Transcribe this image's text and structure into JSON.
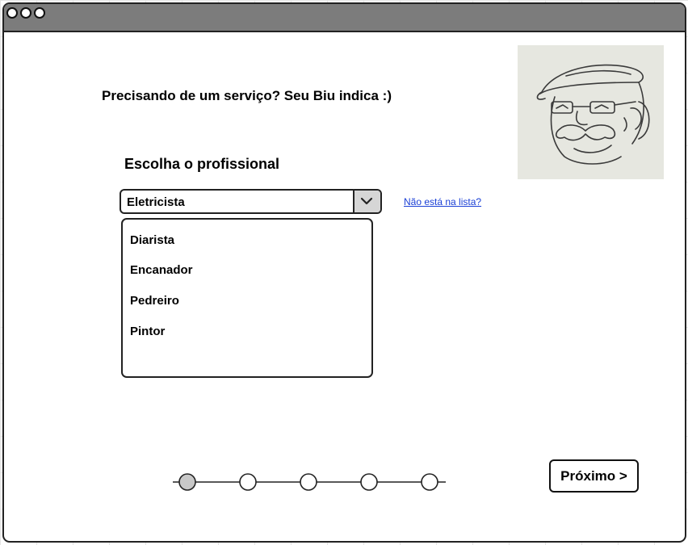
{
  "header": {
    "headline": "Precisando de um serviço? Seu Biu indica :)"
  },
  "avatar": {
    "icon": "seu-biu-sketch-icon"
  },
  "form": {
    "section_title": "Escolha o profissional",
    "select": {
      "selected_value": "Eletricista",
      "arrow_icon": "chevron-down-icon",
      "options": [
        "Diarista",
        "Encanador",
        "Pedreiro",
        "Pintor"
      ]
    },
    "not_listed_link": "Não está na lista?"
  },
  "stepper": {
    "total_steps": 5,
    "current_step": 1,
    "colors": {
      "active": "#c8c8c8",
      "inactive": "#ffffff"
    }
  },
  "actions": {
    "next_label": "Próximo >"
  },
  "colors": {
    "titlebar": "#7c7c7c",
    "link": "#1a3fd6",
    "avatar_bg": "#e6e7e0"
  }
}
